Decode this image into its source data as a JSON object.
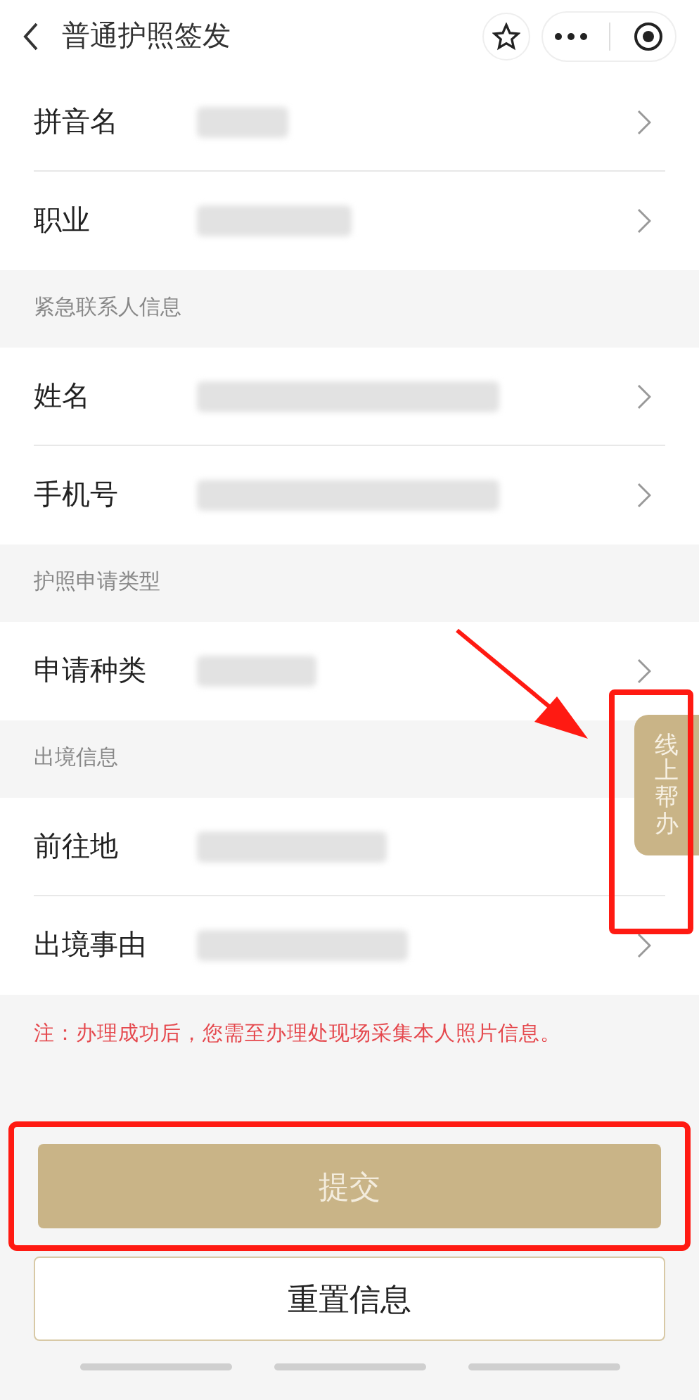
{
  "header": {
    "title": "普通护照签发"
  },
  "sections": [
    {
      "rows": [
        {
          "label": "拼音名",
          "masked": true
        },
        {
          "label": "职业",
          "masked": true
        }
      ]
    },
    {
      "title": "紧急联系人信息",
      "rows": [
        {
          "label": "姓名",
          "masked": true
        },
        {
          "label": "手机号",
          "masked": true
        }
      ]
    },
    {
      "title": "护照申请类型",
      "rows": [
        {
          "label": "申请种类",
          "masked": true
        }
      ]
    },
    {
      "title": "出境信息",
      "rows": [
        {
          "label": "前往地",
          "masked": true,
          "chevron": false
        },
        {
          "label": "出境事由",
          "masked": true
        }
      ]
    }
  ],
  "note": "注：办理成功后，您需至办理处现场采集本人照片信息。",
  "help_tab": {
    "label": "线上帮办",
    "highlighted": true
  },
  "arrow": true,
  "submit": {
    "label": "提交",
    "highlighted": true
  },
  "reset": {
    "label": "重置信息"
  }
}
